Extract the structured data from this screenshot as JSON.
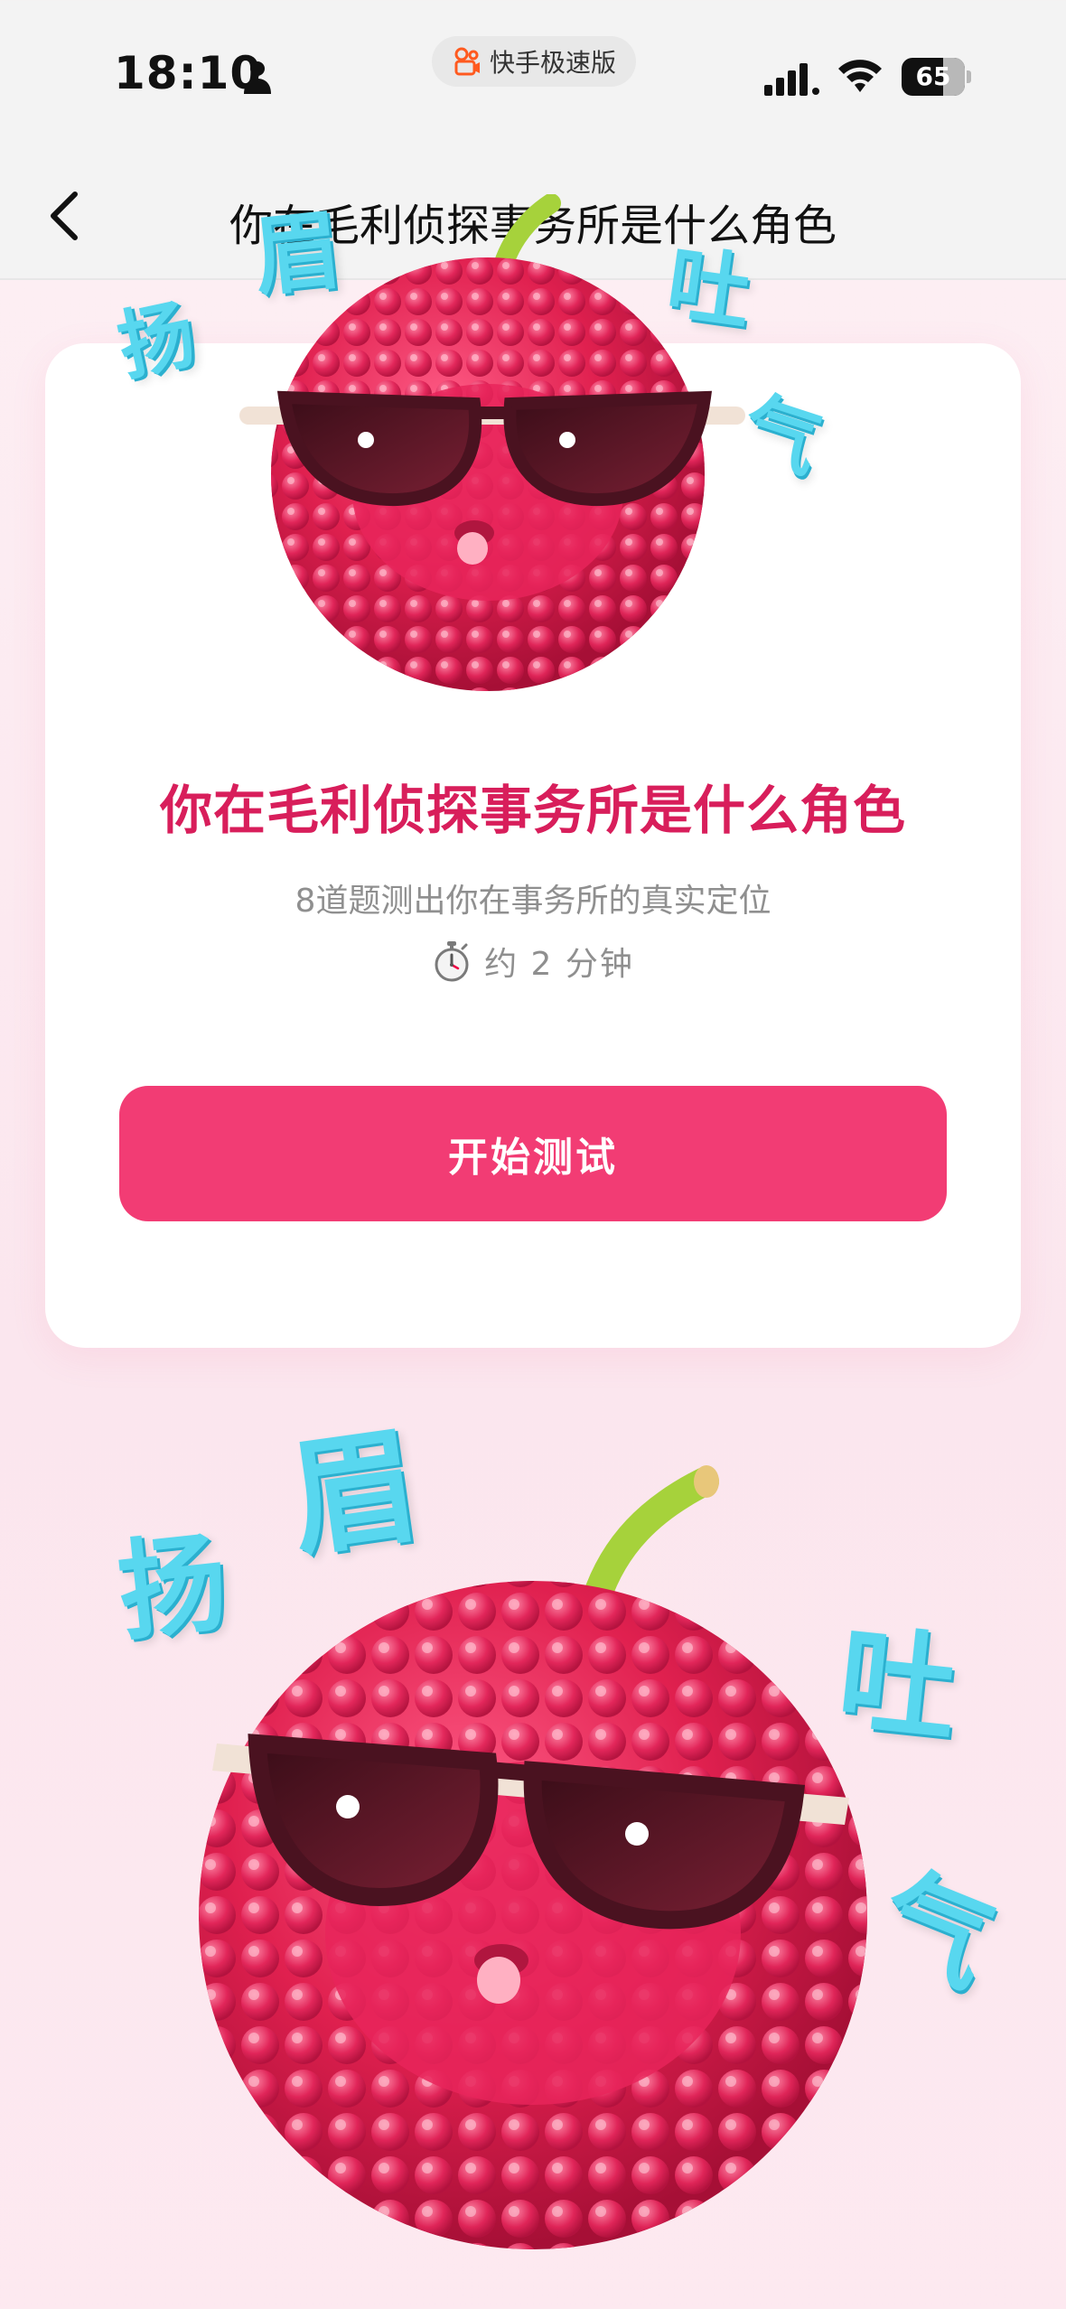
{
  "status_bar": {
    "time": "18:10",
    "app_badge": "快手极速版",
    "battery_level": "65",
    "battery_fraction": 0.65
  },
  "nav": {
    "title": "你在毛利侦探事务所是什么角色"
  },
  "card": {
    "title": "你在毛利侦探事务所是什么角色",
    "subtitle": "8道题测出你在事务所的真实定位",
    "duration": "约 2 分钟",
    "start_button": "开始测试"
  },
  "illustration_text": [
    "扬",
    "眉",
    "吐",
    "气"
  ],
  "colors": {
    "accent_pink": "#f23c74",
    "title_pink": "#d81e5b",
    "deco_cyan": "#58d7ef"
  }
}
